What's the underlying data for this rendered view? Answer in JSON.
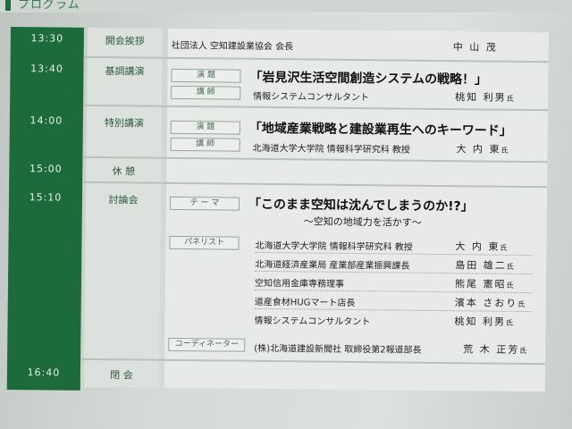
{
  "header": {
    "title": "プログラム"
  },
  "schedule": [
    {
      "time": "13:30",
      "session": "開会挨拶",
      "speaker_org": "社団法人 空知建設業協会 会長",
      "speaker_name": "中 山 茂"
    },
    {
      "time": "13:40",
      "session": "基調講演",
      "tag_title": "演 題",
      "title": "「岩見沢生活空間創造システムの戦略！」",
      "tag_speaker": "講 師",
      "speaker_org": "情報システムコンサルタント",
      "speaker_name": "桃知 利男",
      "honorific": "氏"
    },
    {
      "time": "14:00",
      "session": "特別講演",
      "tag_title": "演 題",
      "title": "「地域産業戦略と建設業再生へのキーワード」",
      "tag_speaker": "講 師",
      "speaker_org": "北海道大学大学院 情報科学研究科 教授",
      "speaker_name": "大 内 東",
      "honorific": "氏"
    },
    {
      "time": "15:00",
      "session": "休 憩"
    },
    {
      "time": "15:10",
      "session": "討論会",
      "tag_theme": "テ ー マ",
      "title": "「このまま空知は沈んでしまうのか!?」",
      "subtitle": "～空知の地域力を活かす～",
      "tag_panelist": "パネリスト",
      "panelists": [
        {
          "org": "北海道大学大学院 情報科学研究科 教授",
          "name": "大 内 東",
          "honorific": "氏"
        },
        {
          "org": "北海道経済産業局 産業部産業振興課長",
          "name": "島田 雄二",
          "honorific": "氏"
        },
        {
          "org": "空知信用金庫専務理事",
          "name": "熊尾 憲昭",
          "honorific": "氏"
        },
        {
          "org": "道産食材HUGマート店長",
          "name": "濱本 さおり",
          "honorific": "氏"
        },
        {
          "org": "情報システムコンサルタント",
          "name": "桃知 利男",
          "honorific": "氏"
        }
      ],
      "tag_coordinator": "コーディネーター",
      "coordinator": {
        "org": "(株)北海道建設新聞社 取締役第2報道部長",
        "name": "荒 木 正芳",
        "honorific": "氏"
      }
    },
    {
      "time": "16:40",
      "session": "閉 会"
    }
  ]
}
